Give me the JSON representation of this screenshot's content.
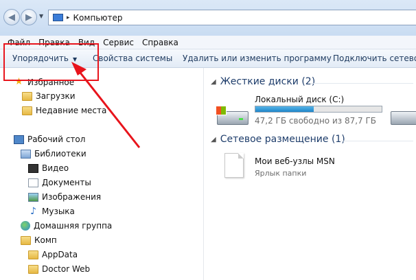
{
  "address_bar": {
    "path_separator": "▸",
    "location": "Компьютер"
  },
  "menu": [
    "Файл",
    "Правка",
    "Вид",
    "Сервис",
    "Справка"
  ],
  "toolbar": {
    "organize": "Упорядочить",
    "system_properties": "Свойства системы",
    "uninstall": "Удалить или изменить программу",
    "map_drive": "Подключить сетевой д"
  },
  "nav_tree": {
    "favorites": "Избранное",
    "downloads": "Загрузки",
    "recent": "Недавние места",
    "desktop": "Рабочий стол",
    "libraries": "Библиотеки",
    "video": "Видео",
    "documents": "Документы",
    "images": "Изображения",
    "music": "Музыка",
    "homegroup": "Домашняя группа",
    "user": "Комп",
    "appdata": "AppData",
    "doctorweb": "Doctor Web"
  },
  "content": {
    "hard_disks_header": "Жесткие диски (2)",
    "disk_c": {
      "name": "Локальный диск (C:)",
      "free_text": "47,2 ГБ свободно из 87,7 ГБ",
      "used_fraction": 0.46
    },
    "network_header": "Сетевое размещение (1)",
    "network_item": {
      "name": "Мои веб-узлы MSN",
      "type": "Ярлык папки"
    }
  },
  "colors": {
    "highlight": "#e8141c",
    "group_header": "#1e3d6b",
    "progress_fill": "#2a90d0"
  }
}
